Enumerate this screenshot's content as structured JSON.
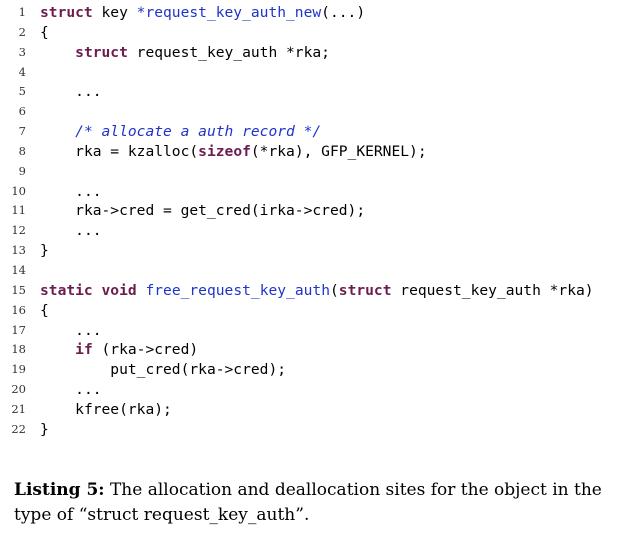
{
  "listing": {
    "lines": [
      {
        "num": "1",
        "indent": "",
        "tokens": [
          {
            "t": "kw",
            "v": "struct"
          },
          {
            "t": "pl",
            "v": " key "
          },
          {
            "t": "fn",
            "v": "*request_key_auth_new"
          },
          {
            "t": "pl",
            "v": "(...)"
          }
        ]
      },
      {
        "num": "2",
        "indent": "",
        "tokens": [
          {
            "t": "pl",
            "v": "{"
          }
        ]
      },
      {
        "num": "3",
        "indent": "    ",
        "tokens": [
          {
            "t": "kw",
            "v": "struct"
          },
          {
            "t": "pl",
            "v": " request_key_auth *rka;"
          }
        ]
      },
      {
        "num": "4",
        "indent": "",
        "tokens": []
      },
      {
        "num": "5",
        "indent": "    ",
        "tokens": [
          {
            "t": "pl",
            "v": "..."
          }
        ]
      },
      {
        "num": "6",
        "indent": "",
        "tokens": []
      },
      {
        "num": "7",
        "indent": "    ",
        "tokens": [
          {
            "t": "cm",
            "v": "/* allocate a auth record */"
          }
        ]
      },
      {
        "num": "8",
        "indent": "    ",
        "tokens": [
          {
            "t": "pl",
            "v": "rka = kzalloc("
          },
          {
            "t": "kw",
            "v": "sizeof"
          },
          {
            "t": "pl",
            "v": "(*rka), GFP_KERNEL);"
          }
        ]
      },
      {
        "num": "9",
        "indent": "",
        "tokens": []
      },
      {
        "num": "10",
        "indent": "    ",
        "tokens": [
          {
            "t": "pl",
            "v": "..."
          }
        ]
      },
      {
        "num": "11",
        "indent": "    ",
        "tokens": [
          {
            "t": "pl",
            "v": "rka->cred = get_cred(irka->cred);"
          }
        ]
      },
      {
        "num": "12",
        "indent": "    ",
        "tokens": [
          {
            "t": "pl",
            "v": "..."
          }
        ]
      },
      {
        "num": "13",
        "indent": "",
        "tokens": [
          {
            "t": "pl",
            "v": "}"
          }
        ]
      },
      {
        "num": "14",
        "indent": "",
        "tokens": []
      },
      {
        "num": "15",
        "indent": "",
        "tokens": [
          {
            "t": "kw",
            "v": "static"
          },
          {
            "t": "pl",
            "v": " "
          },
          {
            "t": "kw",
            "v": "void"
          },
          {
            "t": "pl",
            "v": " "
          },
          {
            "t": "fn",
            "v": "free_request_key_auth"
          },
          {
            "t": "pl",
            "v": "("
          },
          {
            "t": "kw",
            "v": "struct"
          },
          {
            "t": "pl",
            "v": " request_key_auth *rka)"
          }
        ]
      },
      {
        "num": "16",
        "indent": "",
        "tokens": [
          {
            "t": "pl",
            "v": "{"
          }
        ]
      },
      {
        "num": "17",
        "indent": "    ",
        "tokens": [
          {
            "t": "pl",
            "v": "..."
          }
        ]
      },
      {
        "num": "18",
        "indent": "    ",
        "tokens": [
          {
            "t": "kw",
            "v": "if"
          },
          {
            "t": "pl",
            "v": " (rka->cred)"
          }
        ]
      },
      {
        "num": "19",
        "indent": "        ",
        "tokens": [
          {
            "t": "pl",
            "v": "put_cred(rka->cred);"
          }
        ]
      },
      {
        "num": "20",
        "indent": "    ",
        "tokens": [
          {
            "t": "pl",
            "v": "..."
          }
        ]
      },
      {
        "num": "21",
        "indent": "    ",
        "tokens": [
          {
            "t": "pl",
            "v": "kfree(rka);"
          }
        ]
      },
      {
        "num": "22",
        "indent": "",
        "tokens": [
          {
            "t": "pl",
            "v": "}"
          }
        ]
      }
    ]
  },
  "caption": {
    "label": "Listing 5:",
    "text": " The allocation and deallocation sites for the object in the type of “struct request_key_auth”."
  },
  "colors": {
    "keyword": "#6b1e4e",
    "function": "#1f34c8",
    "comment": "#1f34c8"
  }
}
